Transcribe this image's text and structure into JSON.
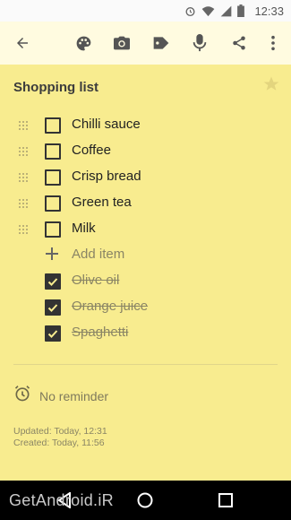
{
  "status_bar": {
    "time": "12:33",
    "icons": [
      "alarm-icon",
      "wifi-icon",
      "signal-icon",
      "battery-icon"
    ]
  },
  "toolbar": {
    "icons": [
      "back-arrow-icon",
      "palette-icon",
      "camera-icon",
      "label-icon",
      "microphone-icon",
      "share-icon",
      "more-vert-icon"
    ]
  },
  "note": {
    "title": "Shopping list",
    "unchecked_items": [
      "Chilli sauce",
      "Coffee",
      "Crisp bread",
      "Green tea",
      "Milk"
    ],
    "add_item_label": "Add item",
    "checked_items": [
      "Olive oil",
      "Orange juice",
      "Spaghetti"
    ],
    "reminder_label": "No reminder",
    "updated": "Updated: Today, 12:31",
    "created": "Created: Today, 11:56"
  },
  "nav_bar": {
    "buttons": [
      "back-icon",
      "home-icon",
      "recents-icon"
    ]
  },
  "watermark": "GetAndroid.iR",
  "colors": {
    "note_background": "#f8ec8f",
    "toolbar_background": "#fffbe0",
    "text_dark": "#222222",
    "text_muted": "#8a8565"
  }
}
